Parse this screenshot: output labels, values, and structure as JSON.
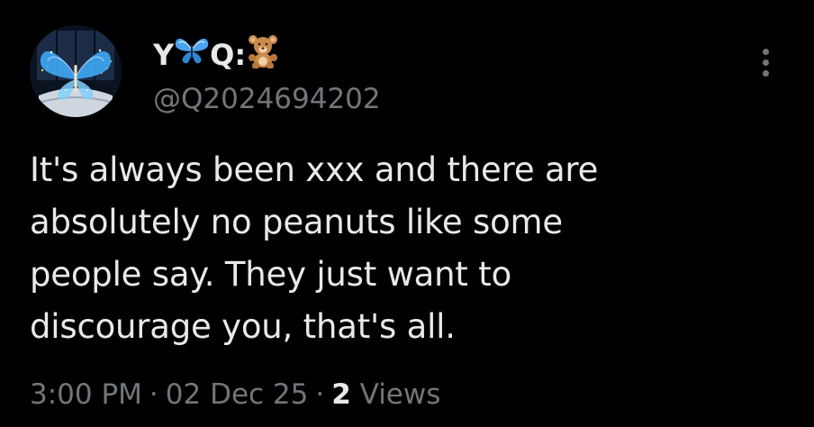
{
  "author": {
    "display_name_prefix": "Y",
    "display_name_suffix": "Q:",
    "display_name_emojis": [
      "butterfly-emoji",
      "teddy-bear-emoji"
    ],
    "handle": "@Q2024694202"
  },
  "tweet": {
    "text": "It's always been xxx and there are\nabsolutely no peanuts like some\npeople say. They just want to\ndiscourage you, that's all."
  },
  "meta": {
    "time": "3:00 PM",
    "separator": "·",
    "date": "02 Dec 25",
    "views_count": "2",
    "views_label": "Views"
  },
  "colors": {
    "background": "#000000",
    "primary_text": "#e7e9ea",
    "secondary_text": "#71767b",
    "butterfly_blue": "#3fa9f5"
  },
  "icons": {
    "more": "more-vertical-icon"
  }
}
